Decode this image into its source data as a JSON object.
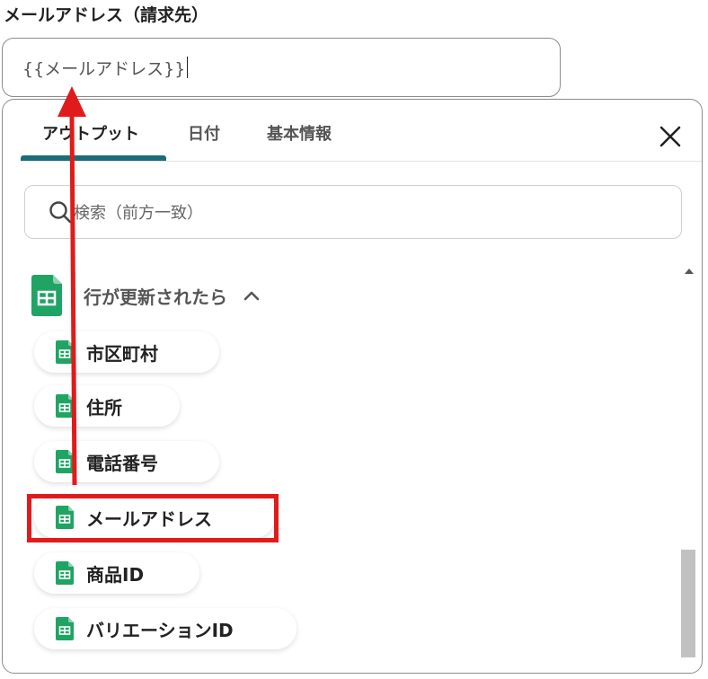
{
  "field": {
    "label": "メールアドレス（請求先）",
    "value": "{{メールアドレス}}"
  },
  "tabs": [
    {
      "label": "アウトプット",
      "active": true
    },
    {
      "label": "日付",
      "active": false
    },
    {
      "label": "基本情報",
      "active": false
    }
  ],
  "search": {
    "placeholder": "検索（前方一致）"
  },
  "group": {
    "title": "行が更新されたら",
    "icon": "google-sheets-icon",
    "expanded": true
  },
  "items": [
    {
      "label": "市区町村"
    },
    {
      "label": "住所"
    },
    {
      "label": "電話番号"
    },
    {
      "label": "メールアドレス",
      "highlighted": true
    },
    {
      "label": "商品ID"
    },
    {
      "label": "バリエーションID"
    }
  ],
  "colors": {
    "accent": "#1b6c78",
    "sheets_green": "#1fa463",
    "annotation_red": "#e01b1b"
  }
}
